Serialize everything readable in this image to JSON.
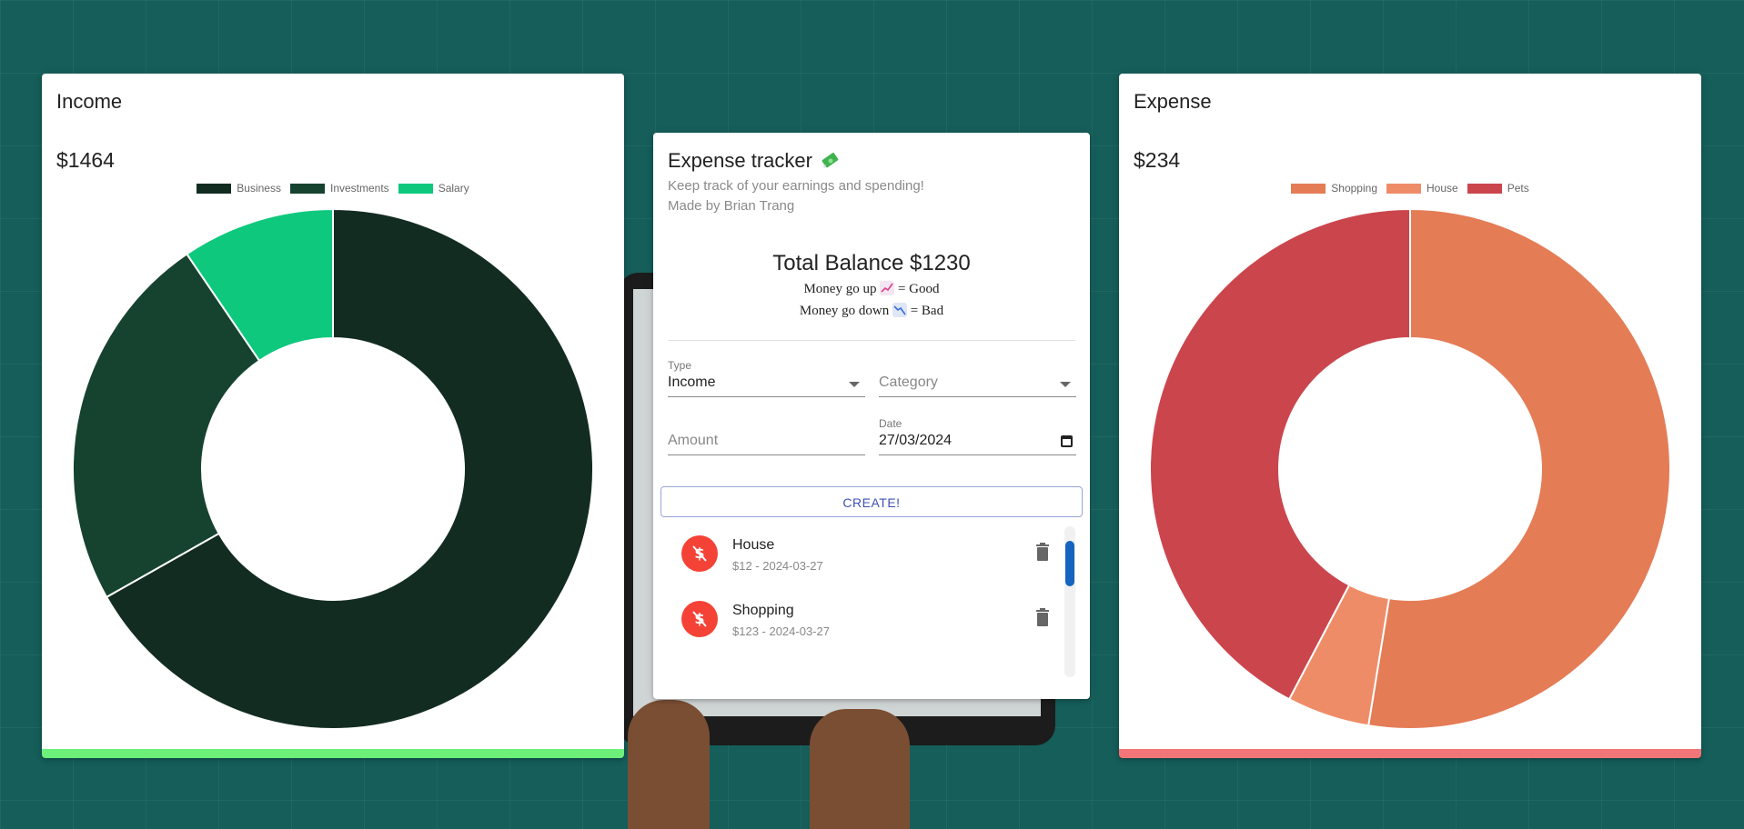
{
  "colors": {
    "income_bar": "#6cf07a",
    "expense_bar": "#f27577",
    "avatar": "#f44336",
    "create_button": "#3f51b5",
    "scroll_thumb": "#1565c0"
  },
  "income": {
    "title": "Income",
    "amount": "$1464",
    "chart_data": {
      "type": "pie",
      "variant": "donut",
      "categories": [
        "Business",
        "Investments",
        "Salary"
      ],
      "values": [
        978,
        347,
        139
      ],
      "colors": [
        "#132c22",
        "#16432f",
        "#0ec87e"
      ],
      "legend_position": "top"
    }
  },
  "expense": {
    "title": "Expense",
    "amount": "$234",
    "chart_data": {
      "type": "pie",
      "variant": "donut",
      "categories": [
        "Shopping",
        "House",
        "Pets"
      ],
      "values": [
        123,
        12,
        99
      ],
      "colors": [
        "#e47c56",
        "#ef8c68",
        "#cb454d"
      ],
      "legend_position": "top"
    }
  },
  "tracker": {
    "title": "Expense tracker",
    "title_icon": "money-with-wings-icon",
    "subtitle": "Keep track of your earnings and spending!",
    "author": "Made by Brian Trang",
    "balance": "Total Balance $1230",
    "note_up_pre": "Money go up",
    "note_up_post": "= Good",
    "note_down_pre": "Money go down",
    "note_down_post": "= Bad",
    "form": {
      "type_label": "Type",
      "type_value": "Income",
      "category_placeholder": "Category",
      "amount_placeholder": "Amount",
      "date_label": "Date",
      "date_value": "27/03/2024"
    },
    "create_label": "CREATE!",
    "transactions": [
      {
        "name": "House",
        "meta": "$12 - 2024-03-27"
      },
      {
        "name": "Shopping",
        "meta": "$123 - 2024-03-27"
      }
    ]
  }
}
